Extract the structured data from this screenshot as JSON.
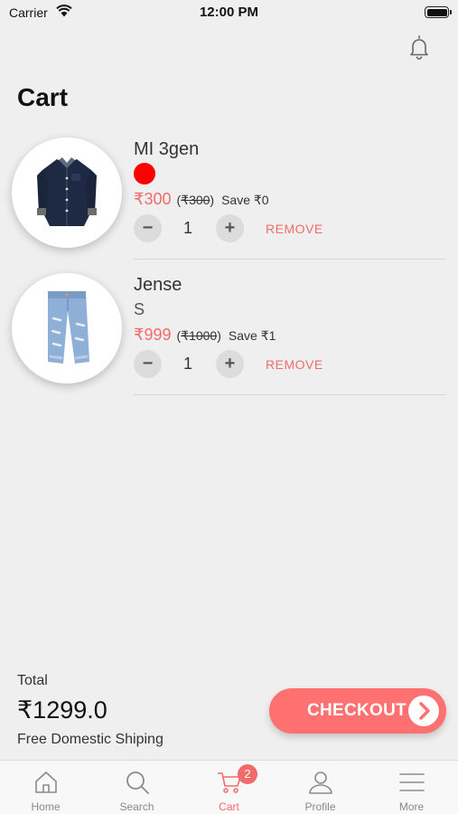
{
  "status_bar": {
    "carrier": "Carrier",
    "time": "12:00 PM"
  },
  "header": {
    "title": "Cart",
    "notification_icon": "bell-icon"
  },
  "cart_items": [
    {
      "name": "MI 3gen",
      "color": "#ff0000",
      "price": "₹300",
      "paren_open": "(",
      "original_price": "₹300",
      "paren_close": ")",
      "save": "Save ₹0",
      "quantity": "1",
      "remove_label": "REMOVE",
      "minus_label": "−",
      "plus_label": "+",
      "image": "navy-shirt"
    },
    {
      "name": "Jense",
      "size": "S",
      "price": "₹999",
      "paren_open": "(",
      "original_price": "₹1000",
      "paren_close": ")",
      "save": "Save ₹1",
      "quantity": "1",
      "remove_label": "REMOVE",
      "minus_label": "−",
      "plus_label": "+",
      "image": "blue-jeans"
    }
  ],
  "summary": {
    "total_label": "Total",
    "total_value": "₹1299.0",
    "shipping_text": "Free Domestic Shiping",
    "checkout_label": "CHECKOUT"
  },
  "tab_bar": {
    "items": [
      {
        "label": "Home",
        "icon": "home-icon"
      },
      {
        "label": "Search",
        "icon": "search-icon"
      },
      {
        "label": "Cart",
        "icon": "cart-icon",
        "badge": "2",
        "active": true
      },
      {
        "label": "Profile",
        "icon": "user-icon"
      },
      {
        "label": "More",
        "icon": "menu-icon"
      }
    ]
  },
  "colors": {
    "accent": "#f26b6b",
    "checkout": "#ff7070",
    "background": "#efefef"
  }
}
